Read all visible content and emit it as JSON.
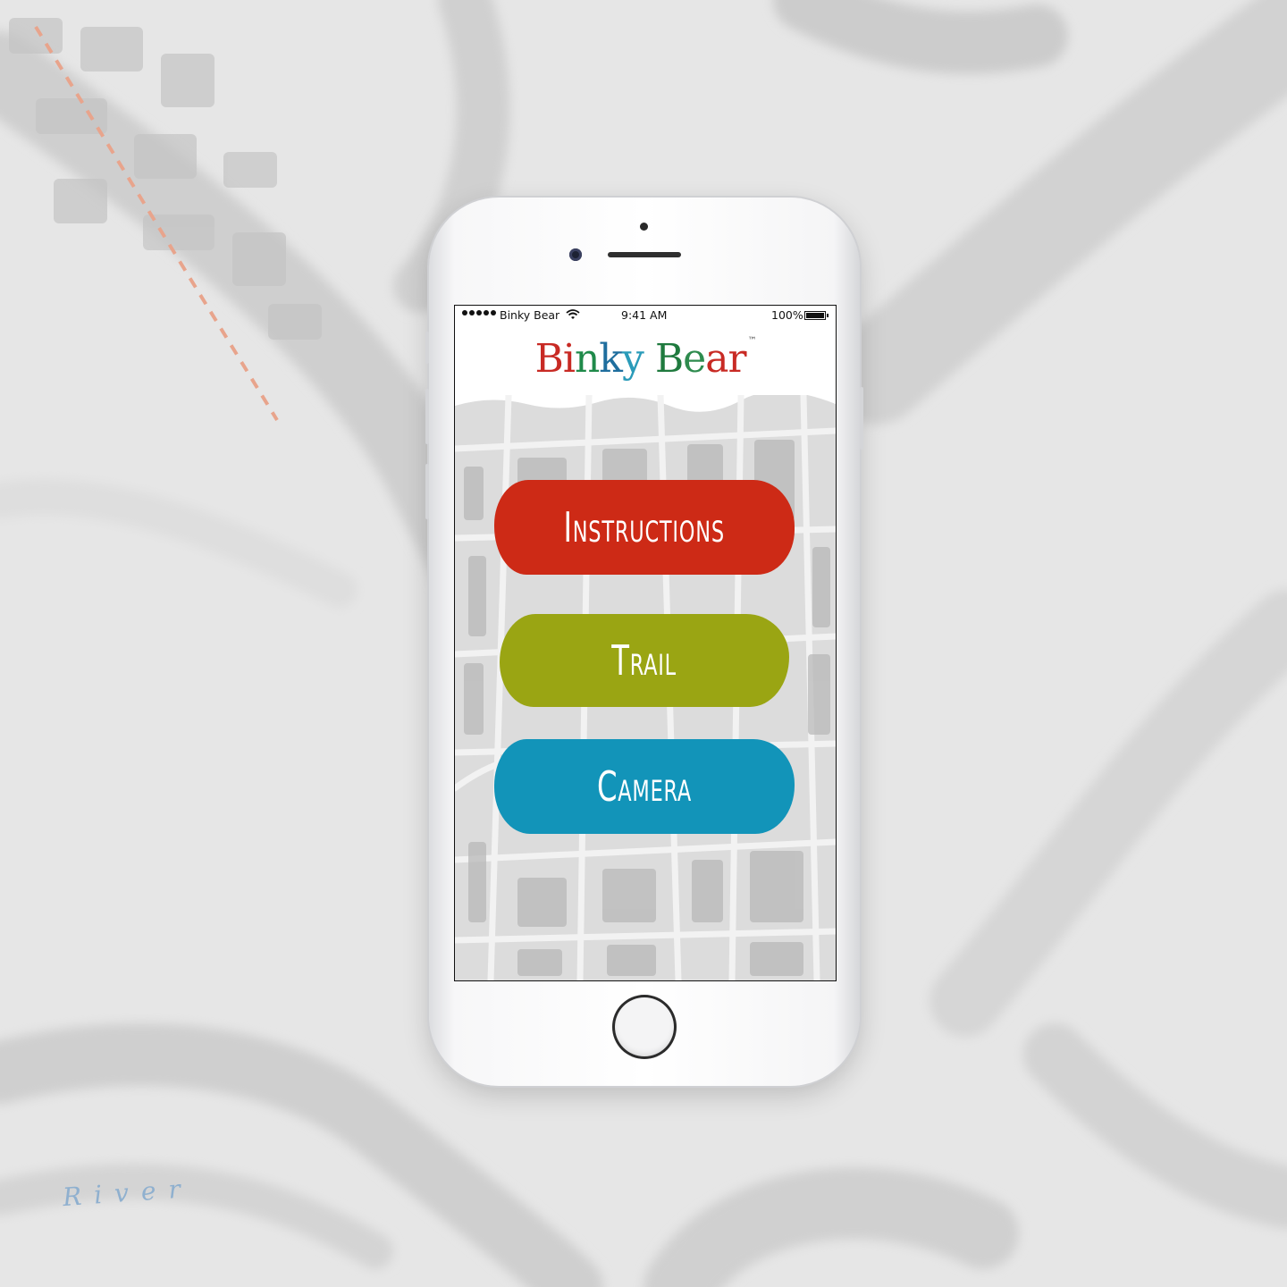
{
  "background": {
    "river_label": "River"
  },
  "status_bar": {
    "carrier": "Binky Bear",
    "time": "9:41 AM",
    "battery_percent": "100%"
  },
  "app": {
    "logo": {
      "letters": [
        {
          "char": "B",
          "color": "#c82a24"
        },
        {
          "char": "i",
          "color": "#c82a24"
        },
        {
          "char": "n",
          "color": "#1f8a4a"
        },
        {
          "char": "k",
          "color": "#1f6e9e"
        },
        {
          "char": "y",
          "color": "#2a9bb9"
        },
        {
          "char": " ",
          "color": "#000000"
        },
        {
          "char": "B",
          "color": "#1f7a3e"
        },
        {
          "char": "e",
          "color": "#2e8b4e"
        },
        {
          "char": "a",
          "color": "#c82a24"
        },
        {
          "char": "r",
          "color": "#c82a24"
        }
      ],
      "trademark": "™"
    },
    "menu": [
      {
        "label": "Instructions",
        "color": "#cd2a16"
      },
      {
        "label": "Trail",
        "color": "#9aa513"
      },
      {
        "label": "Camera",
        "color": "#1294b9"
      }
    ]
  }
}
